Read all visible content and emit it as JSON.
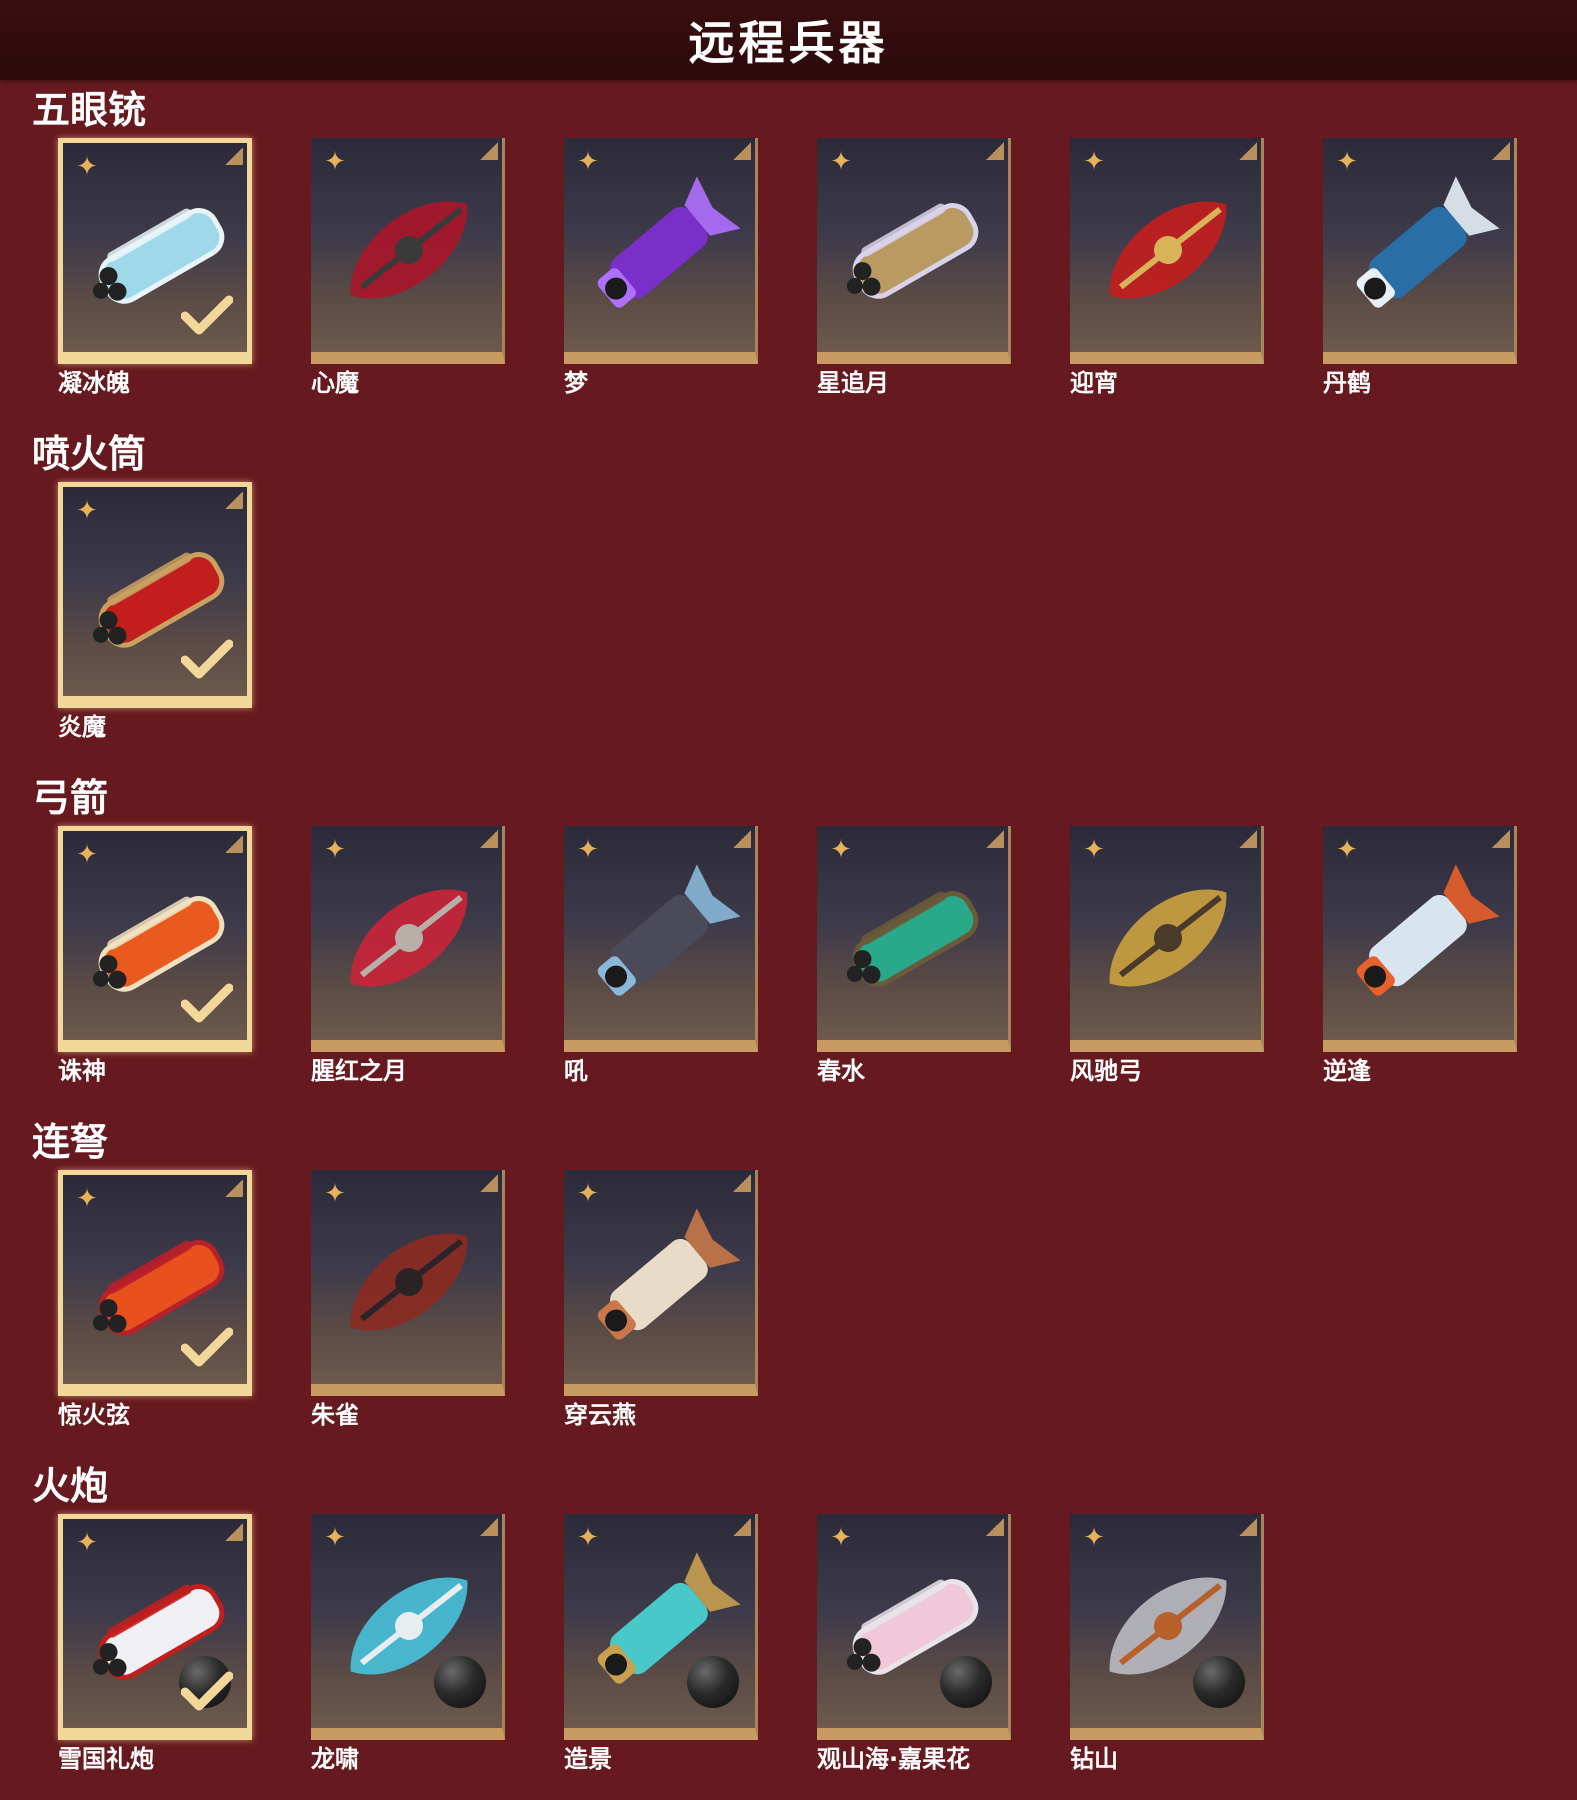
{
  "page": {
    "title": "远程兵器"
  },
  "colors": {
    "background": "#661a1f",
    "topbar": "#2b0a0c",
    "card_frame": "#c89b62",
    "selected_frame": "#f2d79a",
    "star": "#e6b35a"
  },
  "sections": [
    {
      "heading": "五眼铳",
      "items": [
        {
          "name": "凝冰魄",
          "selected": true,
          "icon": "ice-gun-icon",
          "accent": "#9fd8e8",
          "accent2": "#e8f4f8"
        },
        {
          "name": "心魔",
          "selected": false,
          "icon": "demon-gun-icon",
          "accent": "#a8162a",
          "accent2": "#3a3a3a"
        },
        {
          "name": "梦",
          "selected": false,
          "icon": "dream-gun-icon",
          "accent": "#7a2fc8",
          "accent2": "#b070ff"
        },
        {
          "name": "星追月",
          "selected": false,
          "icon": "star-gun-icon",
          "accent": "#b89a62",
          "accent2": "#d8d2ea"
        },
        {
          "name": "迎宵",
          "selected": false,
          "icon": "lion-gun-icon",
          "accent": "#c21e1e",
          "accent2": "#d8b35a"
        },
        {
          "name": "丹鹤",
          "selected": false,
          "icon": "crane-gun-icon",
          "accent": "#2a6ea8",
          "accent2": "#e8f0f6"
        }
      ]
    },
    {
      "heading": "喷火筒",
      "items": [
        {
          "name": "炎魔",
          "selected": true,
          "icon": "flame-tube-icon",
          "accent": "#c21e1e",
          "accent2": "#c8a060"
        }
      ]
    },
    {
      "heading": "弓箭",
      "items": [
        {
          "name": "诛神",
          "selected": true,
          "icon": "fire-bow-icon",
          "accent": "#e85a1e",
          "accent2": "#f0e0c0"
        },
        {
          "name": "腥红之月",
          "selected": false,
          "icon": "crimson-bow-icon",
          "accent": "#c8243a",
          "accent2": "#b8b0a8"
        },
        {
          "name": "吼",
          "selected": false,
          "icon": "roar-bow-icon",
          "accent": "#4a4a58",
          "accent2": "#8ab8d8"
        },
        {
          "name": "春水",
          "selected": false,
          "icon": "jade-bow-icon",
          "accent": "#2aa88a",
          "accent2": "#6a5a3a"
        },
        {
          "name": "风驰弓",
          "selected": false,
          "icon": "wind-bow-icon",
          "accent": "#c8a040",
          "accent2": "#4a3a2a"
        },
        {
          "name": "逆逢",
          "selected": false,
          "icon": "frost-bow-icon",
          "accent": "#d8e4ee",
          "accent2": "#e8602a"
        }
      ]
    },
    {
      "heading": "连弩",
      "items": [
        {
          "name": "惊火弦",
          "selected": true,
          "icon": "fire-crossbow-icon",
          "accent": "#e8501e",
          "accent2": "#b8202a"
        },
        {
          "name": "朱雀",
          "selected": false,
          "icon": "phoenix-crossbow-icon",
          "accent": "#8a2a22",
          "accent2": "#2a2426"
        },
        {
          "name": "穿云燕",
          "selected": false,
          "icon": "swallow-crossbow-icon",
          "accent": "#e8dcc8",
          "accent2": "#c8784a"
        }
      ]
    },
    {
      "heading": "火炮",
      "items": [
        {
          "name": "雪国礼炮",
          "selected": true,
          "icon": "snow-cannon-icon",
          "accent": "#f0f0f4",
          "accent2": "#c21e1e"
        },
        {
          "name": "龙啸",
          "selected": false,
          "icon": "dragon-cannon-icon",
          "accent": "#48c0d8",
          "accent2": "#e8eef0"
        },
        {
          "name": "造景",
          "selected": false,
          "icon": "jade-cannon-icon",
          "accent": "#48c8c8",
          "accent2": "#c8a050"
        },
        {
          "name": "观山海·嘉果花",
          "selected": false,
          "icon": "flower-cannon-icon",
          "accent": "#f0c8d8",
          "accent2": "#e8e4ea"
        },
        {
          "name": "钻山",
          "selected": false,
          "icon": "drill-cannon-icon",
          "accent": "#b8b8c0",
          "accent2": "#b8602a"
        }
      ]
    }
  ]
}
